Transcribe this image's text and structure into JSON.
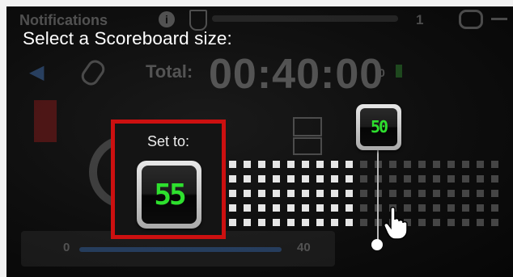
{
  "background_app": {
    "title": "Notifications",
    "counter": "1",
    "total_label": "Total:",
    "time": "00:40:00",
    "extra": "0",
    "slider_min": "0",
    "slider_max": "40",
    "bottom_text": "..."
  },
  "dialog": {
    "prompt": "Select a Scoreboard size:",
    "set_to_label": "Set to:",
    "set_value": "55",
    "hover_value": "50"
  },
  "grid": {
    "selected_columns": 9,
    "selected_rows": 5,
    "total_columns": 19,
    "total_rows": 5
  },
  "colors": {
    "accent_red": "#cc1010",
    "digit_green": "#2ee02e",
    "cell_on": "#e6e6e6",
    "cell_off": "#454545"
  },
  "icons": {
    "cursor": "hand-pointer-icon",
    "loop": "loop-icon",
    "info": "info-icon"
  }
}
